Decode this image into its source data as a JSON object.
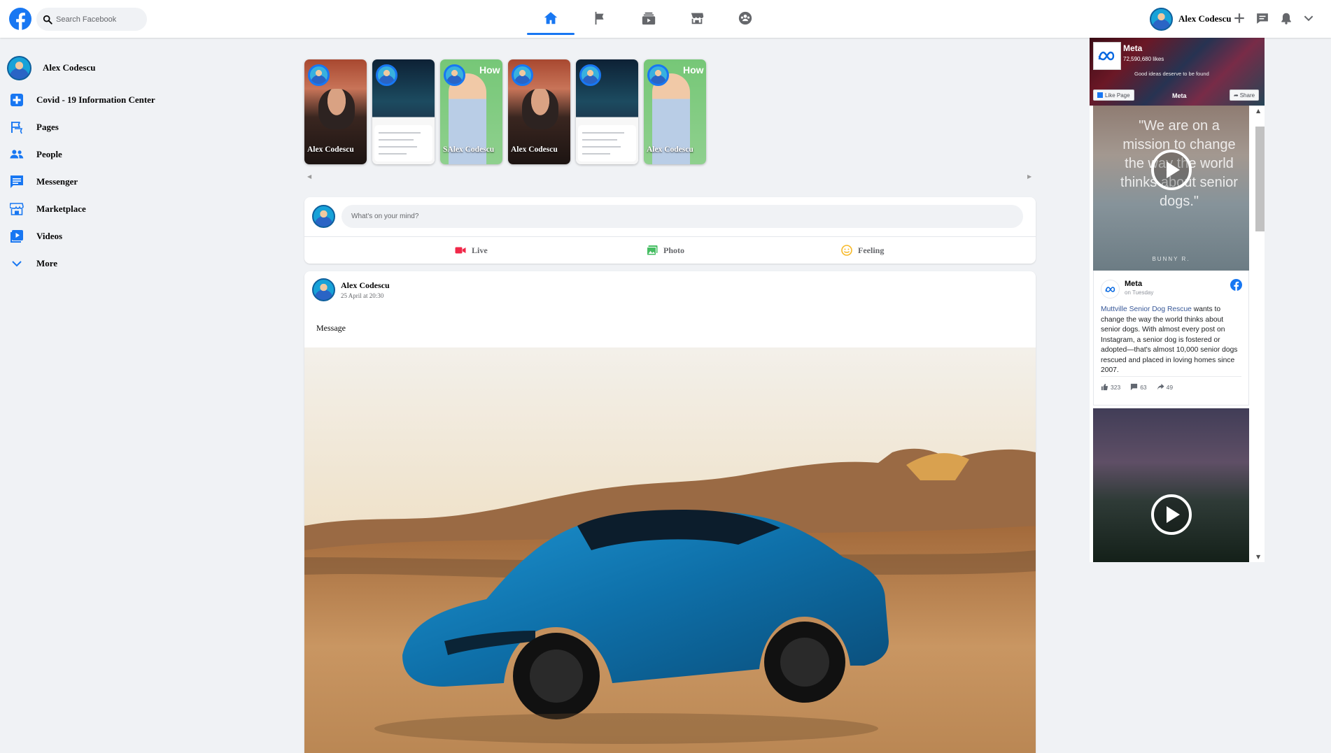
{
  "colors": {
    "brand": "#1877f2",
    "page_bg": "#f0f2f5",
    "live_red": "#f02849",
    "photo_green": "#45bd62",
    "feeling_yellow": "#f7b928"
  },
  "header": {
    "search_placeholder": "Search Facebook",
    "nav_tabs": [
      {
        "icon": "home-icon",
        "active": true
      },
      {
        "icon": "flag-icon",
        "active": false
      },
      {
        "icon": "watch-icon",
        "active": false
      },
      {
        "icon": "marketplace-icon",
        "active": false
      },
      {
        "icon": "groups-icon",
        "active": false
      }
    ],
    "user_name": "Alex Codescu",
    "right_icons": [
      "plus-icon",
      "messenger-icon",
      "notifications-icon",
      "account-chevron-icon"
    ]
  },
  "sidebar": {
    "user": "Alex Codescu",
    "items": [
      {
        "label": "Covid - 19 Information Center",
        "icon": "covid-info-icon"
      },
      {
        "label": "Pages",
        "icon": "pages-flag-icon"
      },
      {
        "label": "People",
        "icon": "people-icon"
      },
      {
        "label": "Messenger",
        "icon": "messenger-icon"
      },
      {
        "label": "Marketplace",
        "icon": "marketplace-icon"
      },
      {
        "label": "Videos",
        "icon": "videos-icon"
      },
      {
        "label": "More",
        "icon": "chevron-down-icon"
      }
    ]
  },
  "stories": [
    {
      "name": "Alex Codescu",
      "style": "beard"
    },
    {
      "name": "",
      "style": "phone"
    },
    {
      "name": "SAlex Codescu",
      "style": "green",
      "overlay": "How To Yo"
    },
    {
      "name": "Alex Codescu",
      "style": "beard"
    },
    {
      "name": "",
      "style": "phone"
    },
    {
      "name": "Alex Codescu",
      "style": "green",
      "overlay": "How To Yo"
    }
  ],
  "composer": {
    "placeholder": "What's on your mind?",
    "actions": [
      {
        "label": "Live",
        "icon": "live-video-icon"
      },
      {
        "label": "Photo",
        "icon": "photo-icon"
      },
      {
        "label": "Feeling",
        "icon": "feeling-icon"
      }
    ]
  },
  "post": {
    "author": "Alex Codescu",
    "date": "25 April at 20:30",
    "message": "Message",
    "image": "blue sports car in desert"
  },
  "page_plugin": {
    "page_name": "Meta",
    "likes": "72,590,680 likes",
    "tagline": "Good ideas deserve to be found",
    "cover_text": "Meta",
    "like_button": "Like Page",
    "share_button": "Share",
    "video1_quote": "\"We are on a mission to change the way the world thinks about senior dogs.\"",
    "video1_signature": "BUNNY R.",
    "card": {
      "name": "Meta",
      "time": "on Tuesday",
      "link_text": "Muttville Senior Dog Rescue",
      "body": " wants to change the way the world thinks about senior dogs. With almost every post on Instagram, a senior dog is fostered or adopted—that's almost 10,000 senior dogs rescued and placed in loving homes since 2007.",
      "likes": "323",
      "comments": "63",
      "shares": "49"
    }
  }
}
